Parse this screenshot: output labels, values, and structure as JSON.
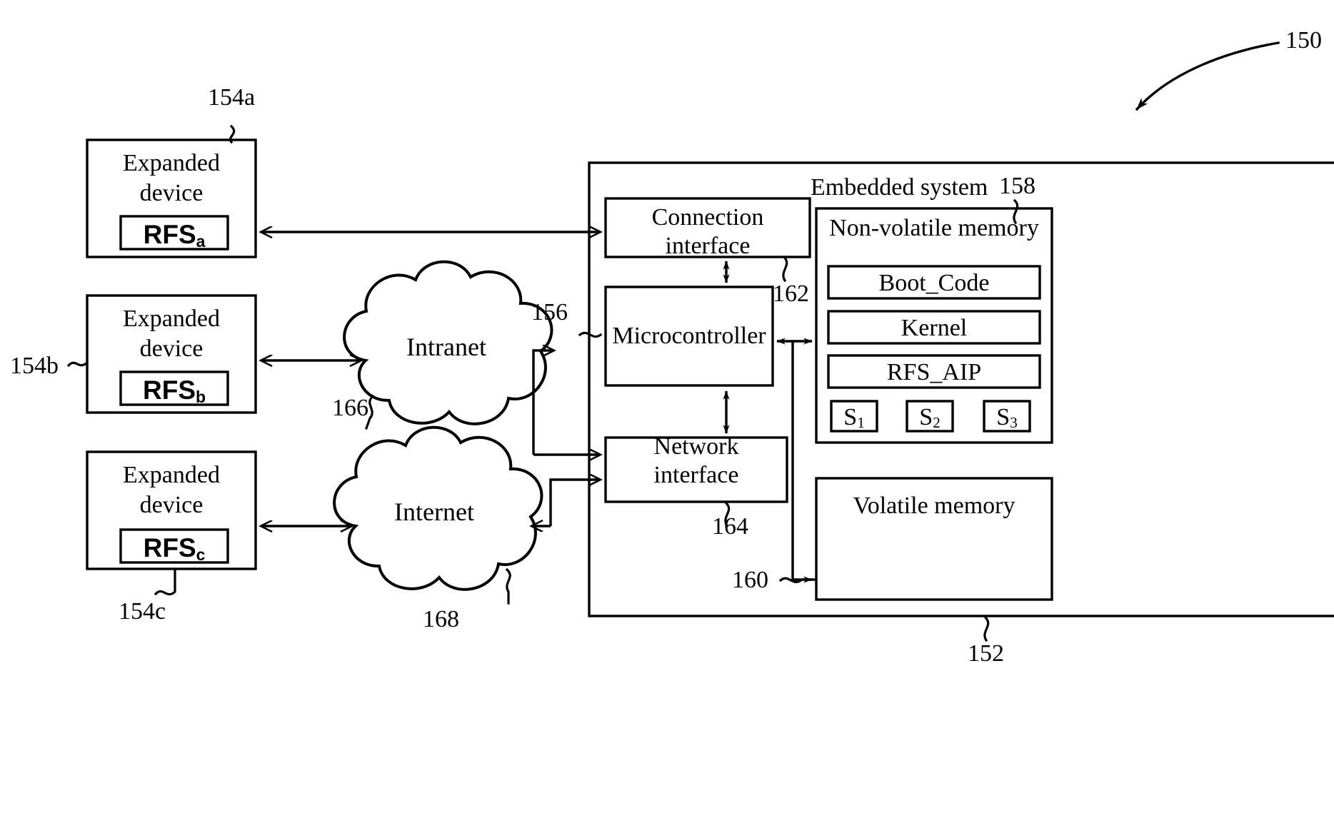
{
  "figure": {
    "title_ref": "150",
    "system_ref": "152",
    "embedded_system_label": "Embedded system",
    "embedded_system_ref": "158"
  },
  "expanded_devices": [
    {
      "id": "a",
      "title_line1": "Expanded",
      "title_line2": "device",
      "rfs_label": "RFS",
      "rfs_sub": "a",
      "ref": "154a"
    },
    {
      "id": "b",
      "title_line1": "Expanded",
      "title_line2": "device",
      "rfs_label": "RFS",
      "rfs_sub": "b",
      "ref": "154b"
    },
    {
      "id": "c",
      "title_line1": "Expanded",
      "title_line2": "device",
      "rfs_label": "RFS",
      "rfs_sub": "c",
      "ref": "154c"
    }
  ],
  "networks": [
    {
      "name": "Intranet",
      "ref": "166"
    },
    {
      "name": "Internet",
      "ref": "168"
    }
  ],
  "embedded": {
    "connection_interface": {
      "line1": "Connection",
      "line2": "interface",
      "ref": "162"
    },
    "microcontroller": {
      "label": "Microcontroller",
      "ref": "156"
    },
    "network_interface": {
      "line1": "Network",
      "line2": "interface",
      "ref": "164"
    },
    "non_volatile_memory": {
      "label": "Non-volatile memory",
      "blocks": [
        "Boot_Code",
        "Kernel",
        "RFS_AIP"
      ],
      "segments": [
        {
          "label": "S",
          "sub": "1"
        },
        {
          "label": "S",
          "sub": "2"
        },
        {
          "label": "S",
          "sub": "3"
        }
      ]
    },
    "volatile_memory": {
      "label": "Volatile memory",
      "ref": "160"
    }
  },
  "colors": {
    "stroke": "#000000",
    "background": "#ffffff"
  }
}
